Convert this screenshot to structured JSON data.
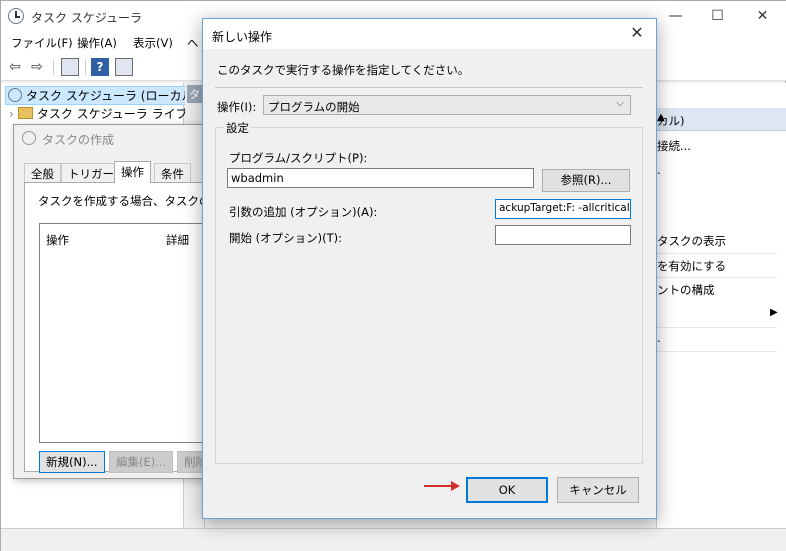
{
  "main_window": {
    "title": "タスク スケジューラ",
    "controls": {
      "minimize": "—",
      "maximize": "☐",
      "close": "✕"
    },
    "menu": [
      "ファイル(F)",
      "操作(A)",
      "表示(V)",
      "ヘ"
    ],
    "tree": {
      "root": "タスク スケジューラ (ローカル)",
      "library": "タスク スケジューラ ライブラリ",
      "expander": "›"
    },
    "middle_header": "タ",
    "actions_panel": {
      "header": "カル)",
      "header_arrow": "▲",
      "items": [
        "接続...",
        ".",
        "タスクの表示",
        "を有効にする",
        "ントの構成",
        "▶",
        "."
      ]
    }
  },
  "create_task": {
    "title": "タスクの作成",
    "tabs": [
      "全般",
      "トリガー",
      "操作",
      "条件"
    ],
    "active_tab": "操作",
    "description": "タスクを作成する場合、タスクの開始",
    "list_columns": [
      "操作",
      "詳細"
    ],
    "buttons": {
      "new": "新規(N)...",
      "edit": "編集(E)...",
      "delete": "削除"
    }
  },
  "new_action": {
    "title": "新しい操作",
    "close": "✕",
    "instruction": "このタスクで実行する操作を指定してください。",
    "action_label": "操作(I):",
    "action_value": "プログラムの開始",
    "chevron": "⌵",
    "settings_title": "設定",
    "program_label": "プログラム/スクリプト(P):",
    "program_value": "wbadmin",
    "browse_label": "参照(R)...",
    "args_label": "引数の追加 (オプション)(A):",
    "args_value": "ackupTarget:F: -allcritical",
    "start_label": "開始 (オプション)(T):",
    "start_value": "",
    "ok_label": "OK",
    "cancel_label": "キャンセル"
  },
  "colors": {
    "accent_blue": "#0078d7",
    "annotation_arrow": "#d0312d",
    "dialog_bg": "#f0f0f0"
  }
}
